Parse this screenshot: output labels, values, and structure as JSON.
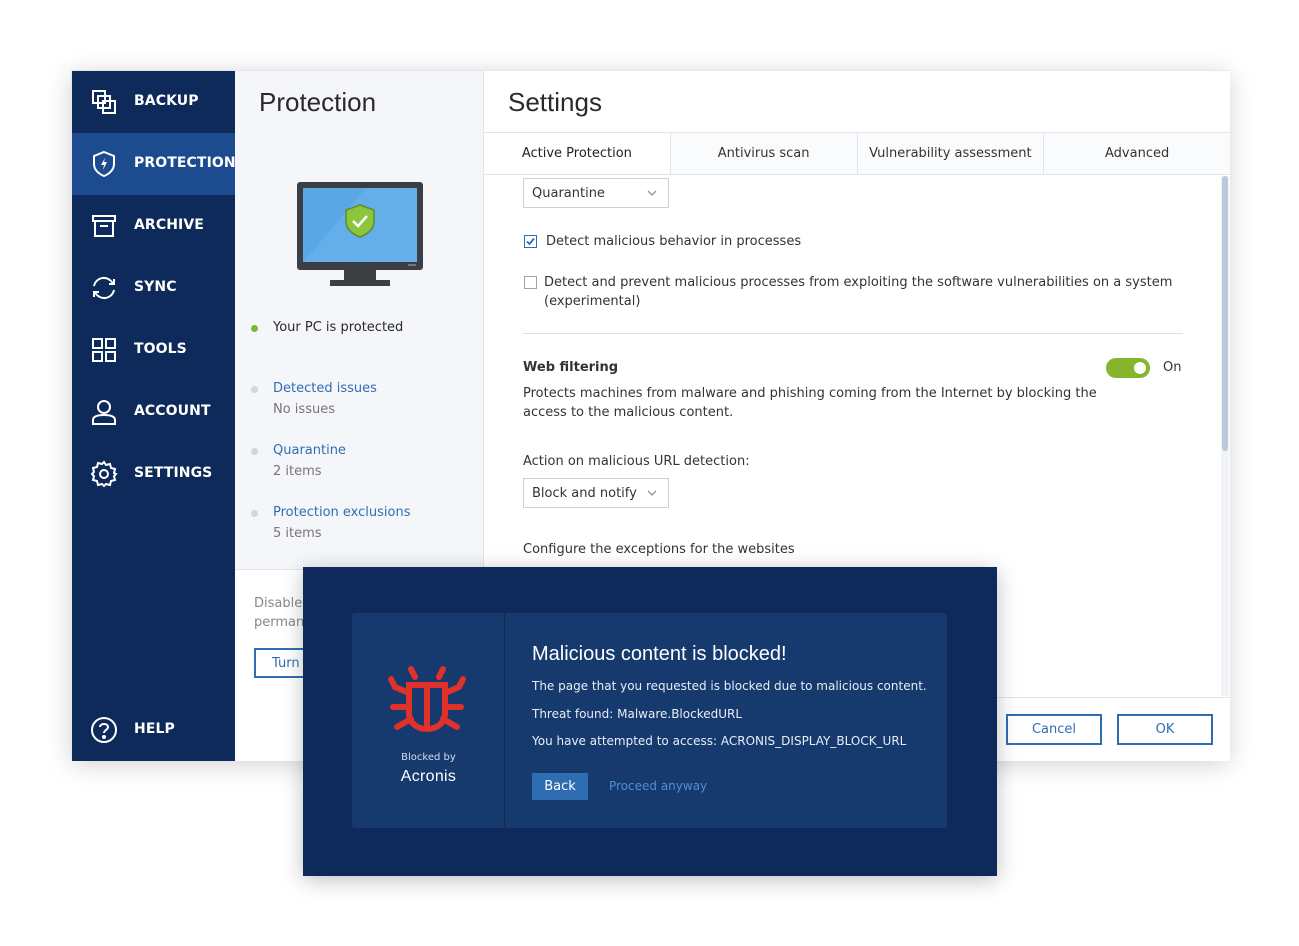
{
  "sidebar": {
    "items": [
      {
        "label": "BACKUP",
        "icon": "backup-icon"
      },
      {
        "label": "PROTECTION",
        "icon": "shield-icon"
      },
      {
        "label": "ARCHIVE",
        "icon": "archive-icon"
      },
      {
        "label": "SYNC",
        "icon": "sync-icon"
      },
      {
        "label": "TOOLS",
        "icon": "grid-icon"
      },
      {
        "label": "ACCOUNT",
        "icon": "user-icon"
      },
      {
        "label": "SETTINGS",
        "icon": "gear-icon"
      }
    ],
    "help": {
      "label": "HELP",
      "icon": "help-icon"
    },
    "active_index": 1
  },
  "protection": {
    "title": "Protection",
    "status": "Your PC is protected",
    "links": [
      {
        "label": "Detected issues",
        "sub": "No issues"
      },
      {
        "label": "Quarantine",
        "sub": "2 items"
      },
      {
        "label": "Protection exclusions",
        "sub": "5 items"
      }
    ],
    "disable_text_line1": "Disable",
    "disable_text_line2": "perman",
    "turn_button": "Turn"
  },
  "settings": {
    "title": "Settings",
    "tabs": [
      "Active Protection",
      "Antivirus scan",
      "Vulnerability assessment",
      "Advanced"
    ],
    "active_tab": 0,
    "quarantine_dropdown": "Quarantine",
    "checkbox_behavior": {
      "label": "Detect malicious behavior in processes",
      "checked": true
    },
    "checkbox_exploit": {
      "label_line1": "Detect and prevent malicious processes from exploiting the software vulnerabilities on a system",
      "label_line2": "(experimental)",
      "checked": false
    },
    "web_filtering": {
      "title": "Web filtering",
      "toggle_label": "On",
      "enabled": true,
      "desc_line1": "Protects machines from malware and phishing coming from the Internet by blocking the",
      "desc_line2": "access to the malicious content."
    },
    "url_action_label": "Action on malicious URL detection:",
    "url_action_dropdown": "Block and notify",
    "exceptions_label": "Configure the exceptions for the websites",
    "cancel_button": "Cancel",
    "ok_button": "OK"
  },
  "blocked_page": {
    "title": "Malicious content is blocked!",
    "line1": "The page that you requested is blocked due to malicious content.",
    "line2": "Threat found: Malware.BlockedURL",
    "line3": "You have attempted to access:  ACRONIS_DISPLAY_BLOCK_URL",
    "blocked_by": "Blocked by",
    "brand": "Acronis",
    "back_button": "Back",
    "proceed_link": "Proceed anyway",
    "colors": {
      "bug": "#e0312b",
      "accent": "#2f6db3",
      "panel": "#0d2a5a"
    }
  }
}
